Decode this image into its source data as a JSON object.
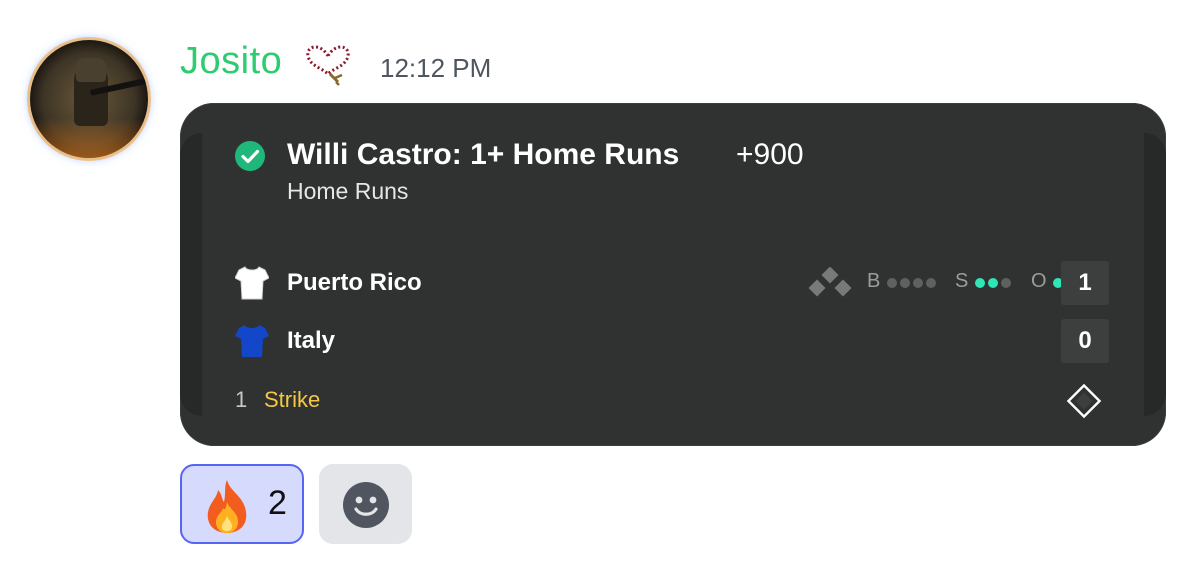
{
  "message": {
    "username": "Josito",
    "timestamp": "12:12 PM",
    "avatar_icon": "soldier-avatar",
    "badge_icon": "rosary-icon",
    "username_color": "#2ecc71"
  },
  "bet_card": {
    "status_icon": "check-circle-icon",
    "title": "Willi Castro: 1+ Home Runs",
    "odds": "+900",
    "market": "Home Runs",
    "teams": [
      {
        "name": "Puerto Rico",
        "score": "1",
        "jersey_color": "#ffffff",
        "jersey_icon": "jersey-icon"
      },
      {
        "name": "Italy",
        "score": "0",
        "jersey_color": "#1346c9",
        "jersey_icon": "jersey-icon"
      }
    ],
    "count": {
      "balls_label": "B",
      "balls": 0,
      "balls_max": 4,
      "strikes_label": "S",
      "strikes": 2,
      "strikes_max": 3,
      "outs_label": "O",
      "outs": 1,
      "outs_max": 3
    },
    "bases_icon": "bases-diamond-icon",
    "status_number": "1",
    "status_text": "Strike",
    "status_color": "#f4c744",
    "accent_color": "#2ee6b6",
    "field_icon": "diamond-outline-icon"
  },
  "reactions": [
    {
      "emoji_icon": "fire-emoji",
      "count": "2"
    }
  ],
  "add_reaction_icon": "smiley-face-icon"
}
